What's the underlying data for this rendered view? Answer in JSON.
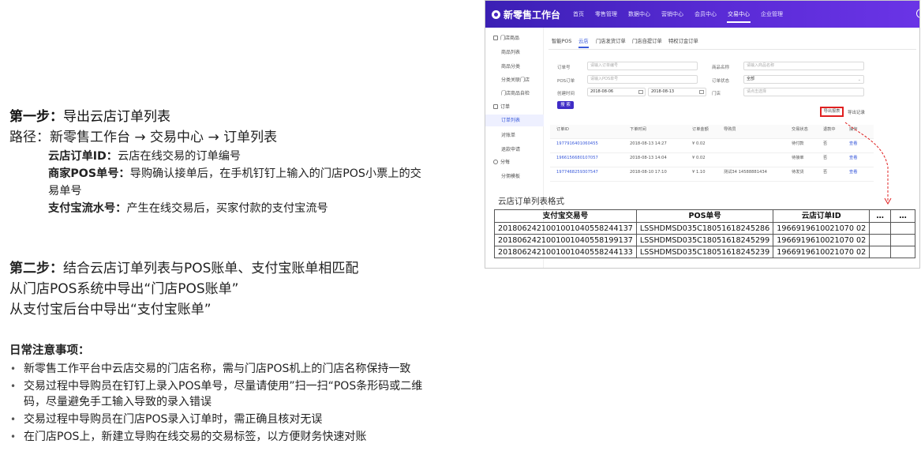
{
  "left": {
    "step1": {
      "title_bold": "第一步：",
      "title_rest": "导出云店订单列表",
      "path": "路径：新零售工作台 → 交易中心 → 订单列表",
      "defs": [
        {
          "term": "云店订单ID：",
          "desc": "云店在线交易的订单编号"
        },
        {
          "term": "商家POS单号：",
          "desc": "导购确认接单后，在手机钉钉上输入的门店POS小票上的交易单号"
        },
        {
          "term": "支付宝流水号：",
          "desc": "产生在线交易后，买家付款的支付宝流号"
        }
      ]
    },
    "step2": {
      "title_bold": "第二步：",
      "title_rest": "结合云店订单列表与POS账单、支付宝账单相匹配",
      "line2": "从门店POS系统中导出“门店POS账单”",
      "line3": "从支付宝后台中导出“支付宝账单”"
    },
    "notes": {
      "title": "日常注意事项：",
      "items": [
        "新零售工作平台中云店交易的门店名称，需与门店POS机上的门店名称保持一致",
        "交易过程中导购员在钉钉上录入POS单号，尽量请使用”扫一扫“POS条形码或二维码，尽量避免手工输入导致的录入错误",
        "交易过程中导购员在门店POS录入订单时，需正确且核对无误",
        "在门店POS上，新建立导购在线交易的交易标签，以方便财务快速对账"
      ]
    }
  },
  "app": {
    "logo": "新零售工作台",
    "nav": [
      "首页",
      "零售管理",
      "数据中心",
      "营销中心",
      "会员中心",
      "交易中心",
      "企业管理"
    ],
    "nav_active_index": 5,
    "sidebar": {
      "g1": "门店商品",
      "g1_items": [
        "商品列表",
        "商品分类",
        "分类关联门店",
        "门店商品自检"
      ],
      "g2": "订单",
      "g2_items": [
        "订单列表",
        "对账单",
        "退款申请"
      ],
      "g3": "分每",
      "g3_items": [
        "分佣模板"
      ]
    },
    "tabs": [
      "智能POS",
      "云店",
      "门店发货订单",
      "门店自提订单",
      "特权订金订单"
    ],
    "tab_active_index": 1,
    "form": {
      "order_no_label": "订单号",
      "order_no_placeholder": "请输入订单编号",
      "product_name_label": "商品名称",
      "product_name_placeholder": "请输入商品名称",
      "pos_label": "POS订单",
      "pos_placeholder": "请输入POS单号",
      "status_label": "订单状态",
      "status_value": "全部",
      "created_label": "创建时间",
      "date_start": "2018-08-06",
      "date_end": "2018-08-13",
      "store_label": "门店",
      "store_placeholder": "请点击选择",
      "search_button": "搜 索",
      "export_button": "导出报表",
      "export_records": "导出记录"
    },
    "order_table": {
      "headers": [
        "订单ID",
        "下单时间",
        "订单金额",
        "导购员",
        "交易状态",
        "退款中",
        "操作"
      ],
      "rows": [
        [
          "1977916401060455",
          "2018-08-13 14:27",
          "¥ 0.02",
          "",
          "待付款",
          "否",
          "查看"
        ],
        [
          "1966156680107057",
          "2018-08-13 14:04",
          "¥ 0.02",
          "",
          "待接单",
          "否",
          "查看"
        ],
        [
          "1977468259307547",
          "2018-08-10 17:10",
          "¥ 1.10",
          "测试34 14588881434",
          "待发货",
          "否",
          "查看"
        ]
      ]
    },
    "format_caption": "云店订单列表格式",
    "format_table": {
      "headers": [
        "支付宝交易号",
        "POS单号",
        "云店订单ID",
        "…",
        "…"
      ],
      "rows": [
        [
          "2018062421001001040558244137",
          "LSSHDMSD035C18051618245286",
          "1966919610021070 02"
        ],
        [
          "2018062421001001040558199137",
          "LSSHDMSD035C18051618245299",
          "1966919610021070 02"
        ],
        [
          "2018062421001001040558244133",
          "LSSHDMSD035C18051618245239",
          "1966919610021070 02"
        ]
      ]
    }
  }
}
